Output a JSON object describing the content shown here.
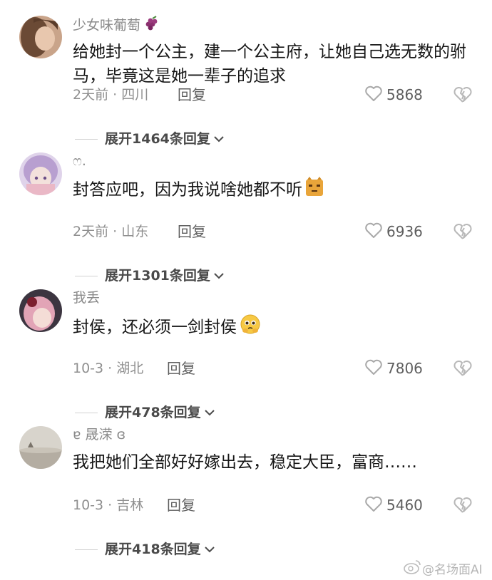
{
  "comments": [
    {
      "username": "少女味葡萄",
      "user_emoji": "grapes-emoji",
      "text": "给她封一个公主，建一个公主府，让她自己选无数的驸马，毕竟这是她一辈子的追求",
      "meta": "2天前 · 四川",
      "reply_label": "回复",
      "likes": "5868",
      "expand_label": "展开1464条回复"
    },
    {
      "username": "ෆ.",
      "text": "封答应吧，因为我说啥她都不听",
      "text_emoji": "cat-emoji",
      "meta": "2天前 · 山东",
      "reply_label": "回复",
      "likes": "6936",
      "expand_label": "展开1301条回复"
    },
    {
      "username": "我丢",
      "text": "封侯，还必须一剑封侯",
      "text_emoji": "pleading-face-emoji",
      "meta": "10-3 · 湖北",
      "reply_label": "回复",
      "likes": "7806",
      "expand_label": "展开478条回复"
    },
    {
      "username": "ɐ 晟溁 ɞ",
      "text": "我把她们全部好好嫁出去，稳定大臣，富商……",
      "meta": "10-3 · 吉林",
      "reply_label": "回复",
      "likes": "5460",
      "expand_label": "展开418条回复"
    }
  ],
  "watermark": "@名场面AI",
  "colors": {
    "text": "#161616",
    "muted": "#8f8f8f",
    "icon": "#b8b8b8"
  }
}
